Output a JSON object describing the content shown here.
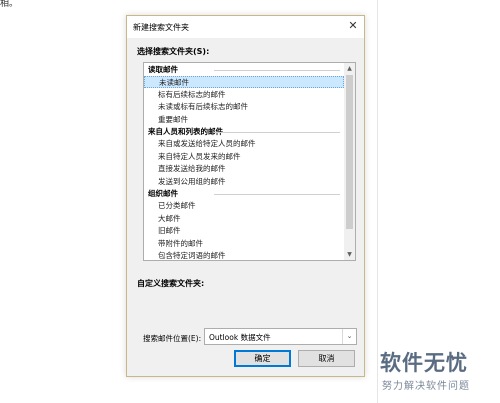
{
  "background_text": "相。",
  "dialog": {
    "title": "新建搜索文件夹",
    "close_glyph": "✕",
    "select_label": "选择搜索文件夹(S):",
    "list": [
      {
        "type": "group",
        "label": "读取邮件"
      },
      {
        "type": "item",
        "label": "未读邮件",
        "selected": true
      },
      {
        "type": "item",
        "label": "标有后续标志的邮件"
      },
      {
        "type": "item",
        "label": "未读或标有后续标志的邮件"
      },
      {
        "type": "item",
        "label": "重要邮件"
      },
      {
        "type": "group",
        "label": "来自人员和列表的邮件"
      },
      {
        "type": "item",
        "label": "来自或发送给特定人员的邮件"
      },
      {
        "type": "item",
        "label": "来自特定人员发来的邮件"
      },
      {
        "type": "item",
        "label": "直接发送给我的邮件"
      },
      {
        "type": "item",
        "label": "发送到公用组的邮件"
      },
      {
        "type": "group",
        "label": "组织邮件"
      },
      {
        "type": "item",
        "label": "已分类邮件"
      },
      {
        "type": "item",
        "label": "大邮件"
      },
      {
        "type": "item",
        "label": "旧邮件"
      },
      {
        "type": "item",
        "label": "带附件的邮件"
      },
      {
        "type": "item",
        "label": "包含特定词语的邮件"
      }
    ],
    "scroll_up_glyph": "▲",
    "scroll_down_glyph": "▼",
    "custom_label": "自定义搜索文件夹:",
    "location_label": "搜索邮件位置(E):",
    "location_value": "Outlook 数据文件",
    "combo_arrow_glyph": "⌄",
    "ok_label": "确定",
    "cancel_label": "取消"
  },
  "watermark": {
    "big": "软件无忧",
    "small": "努力解决软件问题"
  },
  "colors": {
    "selection": "#cce8ff",
    "default_button_border": "#0078d7",
    "dialog_border": "#c9b78a"
  }
}
